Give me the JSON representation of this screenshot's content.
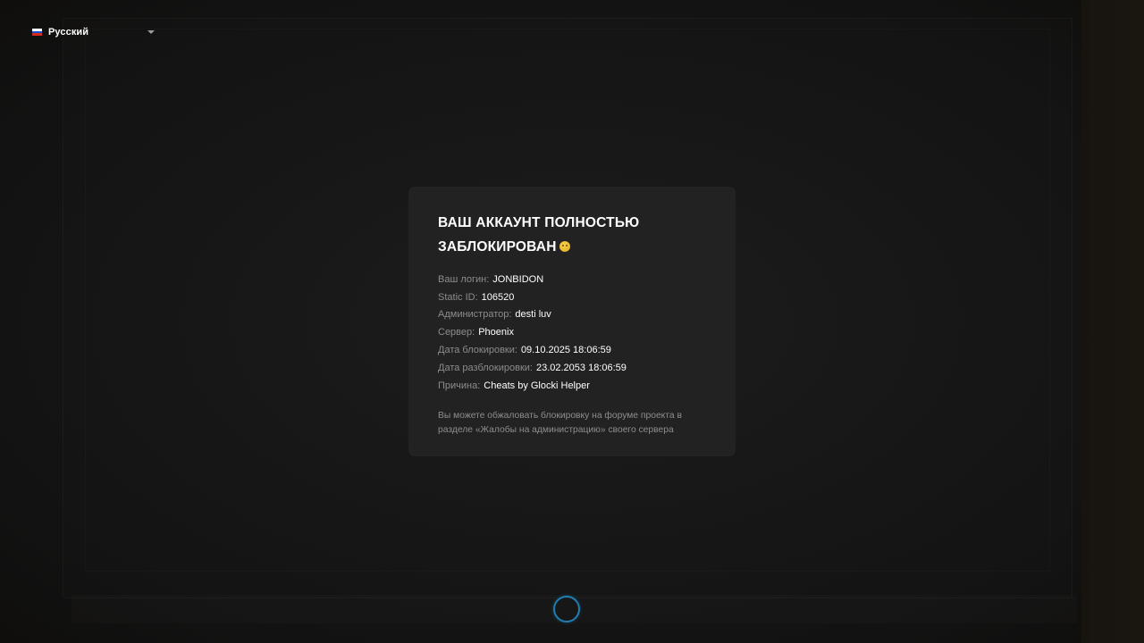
{
  "language": {
    "label": "Русский",
    "flag_icon": "russia-flag-icon",
    "chevron_icon": "chevron-down-icon"
  },
  "ban_card": {
    "title_line1": "ВАШ АККАУНТ ПОЛНОСТЬЮ",
    "title_line2": "ЗАБЛОКИРОВАН",
    "title_emoji": "🥺",
    "fields": [
      {
        "label": "Ваш логин:",
        "value": "JONBIDON"
      },
      {
        "label": "Static ID:",
        "value": "106520"
      },
      {
        "label": "Администратор:",
        "value": "desti luv"
      },
      {
        "label": "Сервер:",
        "value": "Phoenix"
      },
      {
        "label": "Дата блокировки:",
        "value": "09.10.2025 18:06:59"
      },
      {
        "label": "Дата разблокировки:",
        "value": "23.02.2053 18:06:59"
      },
      {
        "label": "Причина:",
        "value": "Cheats by Glocki Helper"
      }
    ],
    "note": "Вы можете обжаловать блокировку на форуме проекта в разделе «Жалобы на администрацию» своего сервера"
  },
  "loading_indicator": "loading-spinner-icon"
}
